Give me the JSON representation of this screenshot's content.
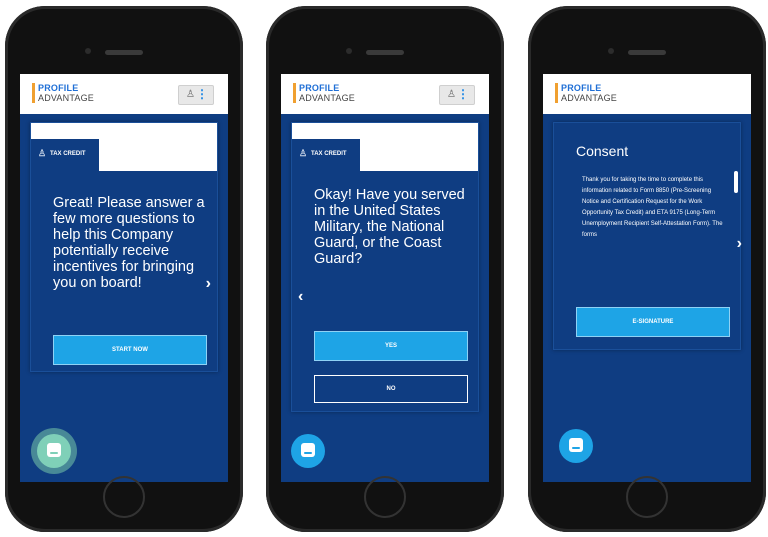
{
  "app": {
    "logo_line1": "PROFILE",
    "logo_line2": "ADVANTAGE",
    "person_icon": "person-icon",
    "menu_icon": "kebab-menu-icon"
  },
  "screens": [
    {
      "tab_label": "TAX CREDIT",
      "question": "Great! Please answer a few more questions to help this Company potentially receive incentives for bringing you on board!",
      "primary_button": "START NOW",
      "next_chevron": "›"
    },
    {
      "tab_label": "TAX CREDIT",
      "question": "Okay! Have you served in the United States Military, the National Guard, or the Coast Guard?",
      "yes_button": "YES",
      "no_button": "NO",
      "prev_chevron": "‹"
    },
    {
      "title": "Consent",
      "body": "Thank you for taking the time to complete this information related to Form 8850 (Pre-Screening Notice and Certification Request for the Work Opportunity Tax Credit) and ETA 9175 (Long-Term Unemployment Recipient Self-Attestation Form). The forms",
      "primary_button": "E-SIGNATURE",
      "next_chevron": "›"
    }
  ],
  "colors": {
    "screen_bg": "#0f3d82",
    "accent": "#1ea4e6",
    "logo_bar": "#f0a030",
    "logo_text": "#1f6fd6",
    "active_fab": "#7fd0b8"
  }
}
